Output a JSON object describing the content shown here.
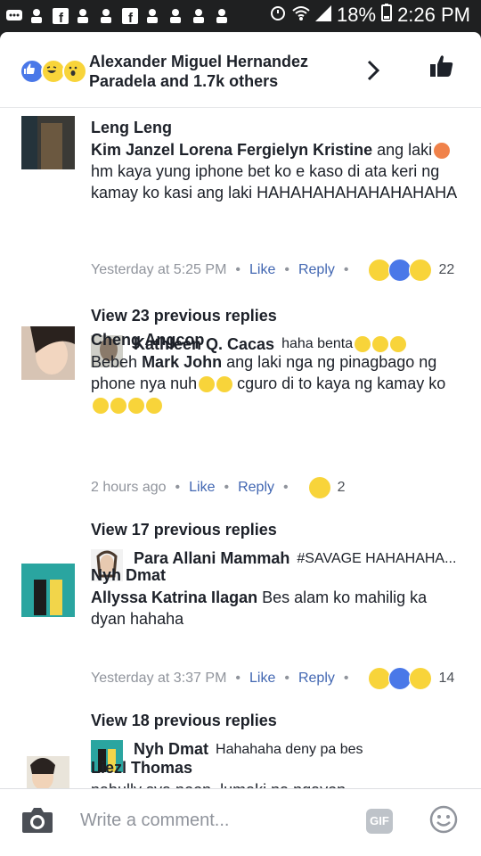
{
  "status_bar": {
    "battery": "18%",
    "time": "2:26 PM"
  },
  "header": {
    "names": "Alexander Miguel Hernandez Paradela and 1.7k others",
    "reactions": [
      "like-icon",
      "haha-icon",
      "wow-icon"
    ]
  },
  "comments": [
    {
      "author": "Leng Leng",
      "mentions": "Kim Janzel Lorena Fergielyn Kristine",
      "text_after": " ang laki",
      "text_line2": "hm kaya yung iphone bet ko e kaso di ata keri ng kamay ko kasi ang laki HAHAHAHAHAHAHAHAHA",
      "time": "Yesterday at 5:25 PM",
      "like": "Like",
      "reply": "Reply",
      "count": "22",
      "view_prev": "View 23 previous replies",
      "reply_name": "Kathleen Q. Cacas",
      "reply_text": "haha benta"
    },
    {
      "author": "Cheng Angcop",
      "line1_pre": "Bebeh ",
      "line1_mention": "Mark John",
      "line1_post": " ang laki nga ng pinagbago ng",
      "line2": "phone nya nuh",
      "line2_post": " cguro di to kaya ng kamay ko",
      "time": "2 hours ago",
      "like": "Like",
      "reply": "Reply",
      "count": "2",
      "view_prev": "View 17 previous replies",
      "reply_name": "Para Allani Mammah",
      "reply_text": "#SAVAGE HAHAHAHA..."
    },
    {
      "author": "Nyh Dmat",
      "mention": "Allyssa Katrina Ilagan",
      "text_after": " Bes alam ko mahilig ka",
      "line2": "dyan hahaha",
      "time": "Yesterday at 3:37 PM",
      "like": "Like",
      "reply": "Reply",
      "count": "14",
      "view_prev": "View 18 previous replies",
      "reply_name": "Nyh Dmat",
      "reply_text": "Hahahaha deny pa bes"
    },
    {
      "author": "Liezl Thomas",
      "text": "nabully sya noon, lumaki na ngayon"
    }
  ],
  "footer": {
    "placeholder": "Write a comment...",
    "gif": "GIF"
  }
}
